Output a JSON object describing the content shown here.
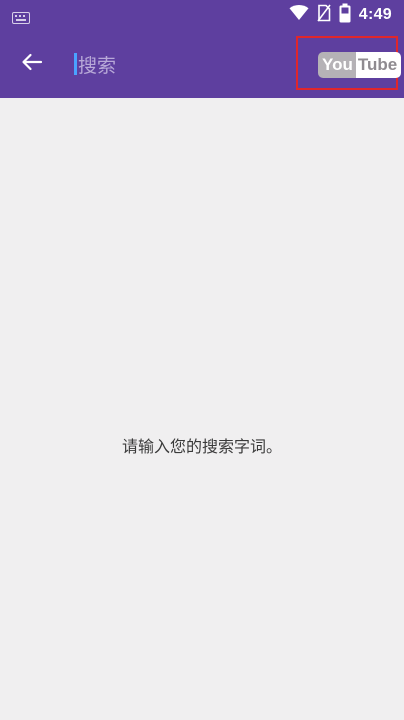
{
  "status_bar": {
    "time": "4:49",
    "icons": [
      "keyboard-icon",
      "wifi-icon",
      "no-sim-icon",
      "battery-icon"
    ]
  },
  "app_bar": {
    "back_icon": "arrow-left-icon",
    "search_text": "搜索",
    "youtube_logo": {
      "you": "You",
      "tube": "Tube"
    }
  },
  "content": {
    "hint": "请输入您的搜索字词。"
  },
  "colors": {
    "app_bar": "#5e3f9f",
    "background": "#f0eff0",
    "highlight_box": "#e0262b",
    "cursor": "#4aa3ff"
  }
}
